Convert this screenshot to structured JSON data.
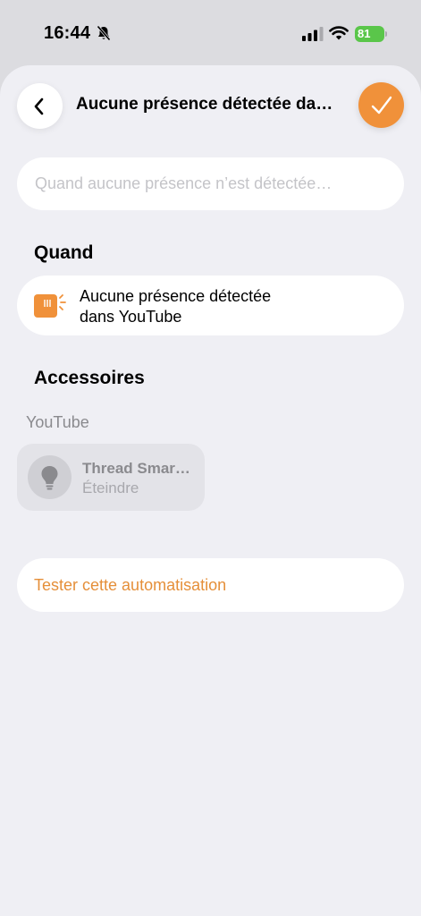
{
  "status_bar": {
    "time": "16:44",
    "battery": "81"
  },
  "header": {
    "title": "Aucune présence détectée da…",
    "back_icon": "chevron-left-icon",
    "done_icon": "checkmark-icon"
  },
  "name_field": {
    "placeholder": "Quand aucune présence n’est détectée…",
    "value": ""
  },
  "when_section": {
    "title": "Quand",
    "trigger": {
      "line1": "Aucune présence détectée",
      "line2": "dans YouTube",
      "icon": "presence-sensor-icon"
    }
  },
  "accessories_section": {
    "title": "Accessoires",
    "room": "YouTube",
    "accessory": {
      "name": "Thread Smar…",
      "state": "Éteindre",
      "icon": "lightbulb-icon"
    }
  },
  "test_button": {
    "label": "Tester cette automatisation"
  },
  "colors": {
    "accent": "#f0913a",
    "battery": "#5ac64a",
    "background": "#efeff4"
  }
}
